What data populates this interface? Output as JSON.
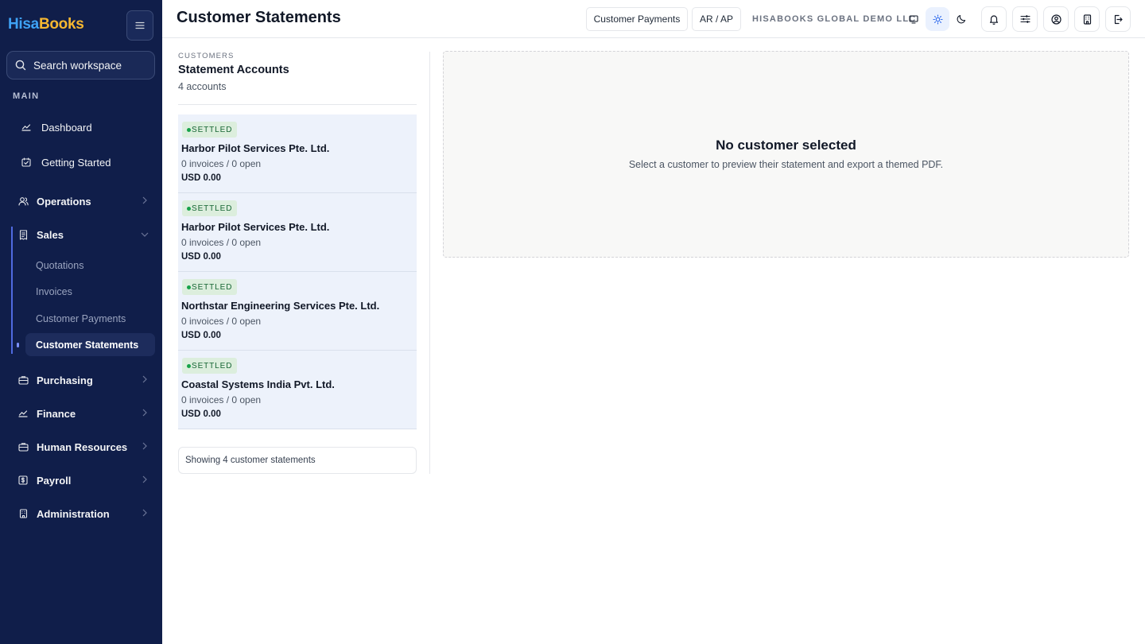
{
  "brand": {
    "part1": "Hisa",
    "part2": "Books"
  },
  "search": {
    "placeholder": "Search workspace"
  },
  "sidebar": {
    "section_label": "MAIN",
    "items": [
      {
        "label": "Dashboard",
        "icon": "chart-line-icon"
      },
      {
        "label": "Getting Started",
        "icon": "calendar-check-icon"
      }
    ],
    "groups": [
      {
        "label": "Operations",
        "icon": "users-icon"
      },
      {
        "label": "Sales",
        "icon": "receipt-icon",
        "expanded": true
      },
      {
        "label": "Purchasing",
        "icon": "briefcase-icon"
      },
      {
        "label": "Finance",
        "icon": "chart-line-icon"
      },
      {
        "label": "Human Resources",
        "icon": "briefcase-icon"
      },
      {
        "label": "Payroll",
        "icon": "dollar-icon"
      },
      {
        "label": "Administration",
        "icon": "building-icon"
      }
    ],
    "sales_children": [
      {
        "label": "Quotations"
      },
      {
        "label": "Invoices"
      },
      {
        "label": "Customer Payments"
      },
      {
        "label": "Customer Statements",
        "active": true
      }
    ]
  },
  "header": {
    "title": "Customer Statements",
    "buttons": {
      "customer_payments": "Customer Payments",
      "ar_ap": "AR / AP"
    },
    "org_name": "HISABOOKS GLOBAL DEMO LLC",
    "theme_mode": "light"
  },
  "list": {
    "eyebrow": "CUSTOMERS",
    "title": "Statement Accounts",
    "count": "4 accounts",
    "accounts": [
      {
        "status": "SETTLED",
        "name": "Harbor Pilot Services Pte. Ltd.",
        "summary": "0 invoices / 0 open",
        "balance": "USD 0.00"
      },
      {
        "status": "SETTLED",
        "name": "Harbor Pilot Services Pte. Ltd.",
        "summary": "0 invoices / 0 open",
        "balance": "USD 0.00"
      },
      {
        "status": "SETTLED",
        "name": "Northstar Engineering Services Pte. Ltd.",
        "summary": "0 invoices / 0 open",
        "balance": "USD 0.00"
      },
      {
        "status": "SETTLED",
        "name": "Coastal Systems India Pvt. Ltd.",
        "summary": "0 invoices / 0 open",
        "balance": "USD 0.00"
      }
    ],
    "footer": "Showing 4 customer statements"
  },
  "preview": {
    "heading": "No customer selected",
    "subtext": "Select a customer to preview their statement and export a themed PDF."
  },
  "colors": {
    "sidebar_bg": "#101e4a",
    "accent": "#4f6ae0",
    "settled": "#16a34a",
    "card_bg": "#edf2fb"
  }
}
